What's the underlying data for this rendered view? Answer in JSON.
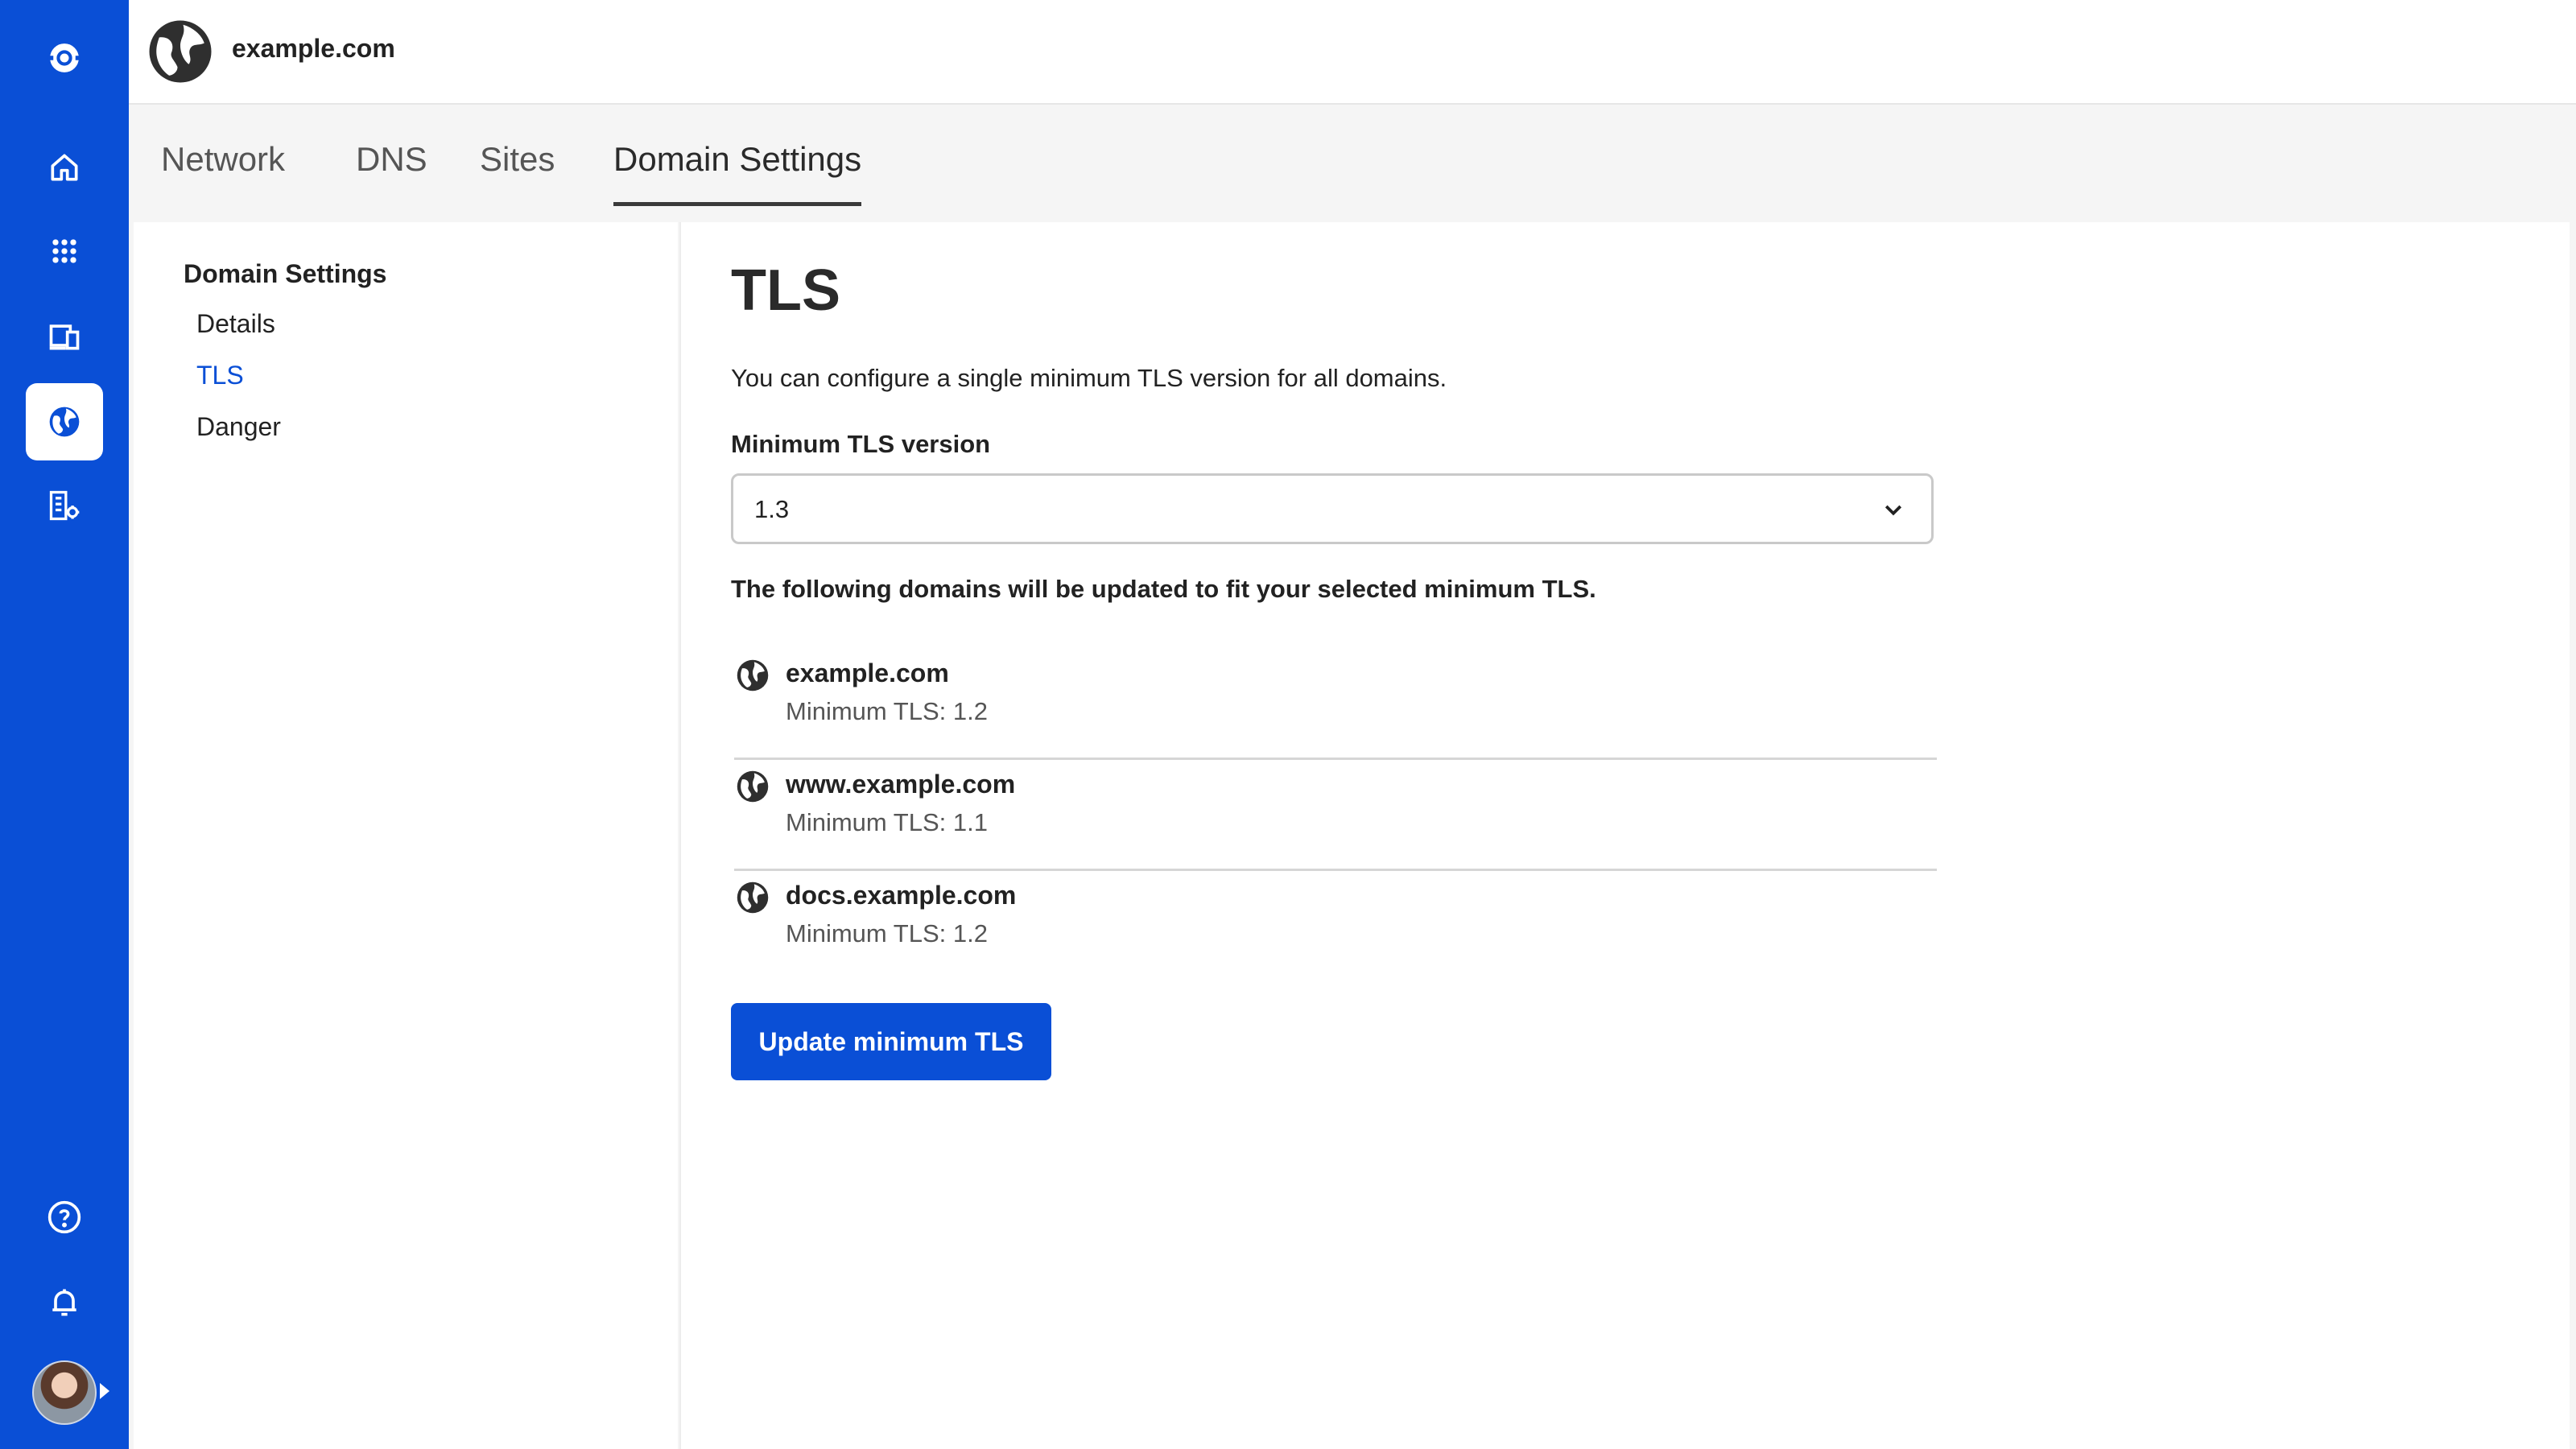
{
  "rail": {
    "items": [
      {
        "name": "home"
      },
      {
        "name": "apps"
      },
      {
        "name": "devices"
      },
      {
        "name": "domains",
        "active": true
      },
      {
        "name": "organization-settings"
      }
    ],
    "bottom": [
      {
        "name": "help"
      },
      {
        "name": "notifications"
      }
    ]
  },
  "header": {
    "site_name": "example.com"
  },
  "tabs": [
    "Network",
    "DNS",
    "Sites",
    "Domain Settings"
  ],
  "active_tab": "Domain Settings",
  "subnav": {
    "title": "Domain Settings",
    "items": [
      "Details",
      "TLS",
      "Danger"
    ],
    "active": "TLS"
  },
  "panel": {
    "title": "TLS",
    "description": "You can configure a single minimum TLS version for all domains.",
    "field_label": "Minimum TLS version",
    "selected_version": "1.3",
    "notice": "The following domains will be updated to fit your selected minimum TLS.",
    "domains": [
      {
        "name": "example.com",
        "tls": "Minimum TLS: 1.2"
      },
      {
        "name": "www.example.com",
        "tls": "Minimum TLS: 1.1"
      },
      {
        "name": "docs.example.com",
        "tls": "Minimum TLS: 1.2"
      }
    ],
    "button_label": "Update minimum TLS"
  },
  "colors": {
    "brand": "#0a4fd6",
    "text": "#222222",
    "muted": "#555555"
  }
}
